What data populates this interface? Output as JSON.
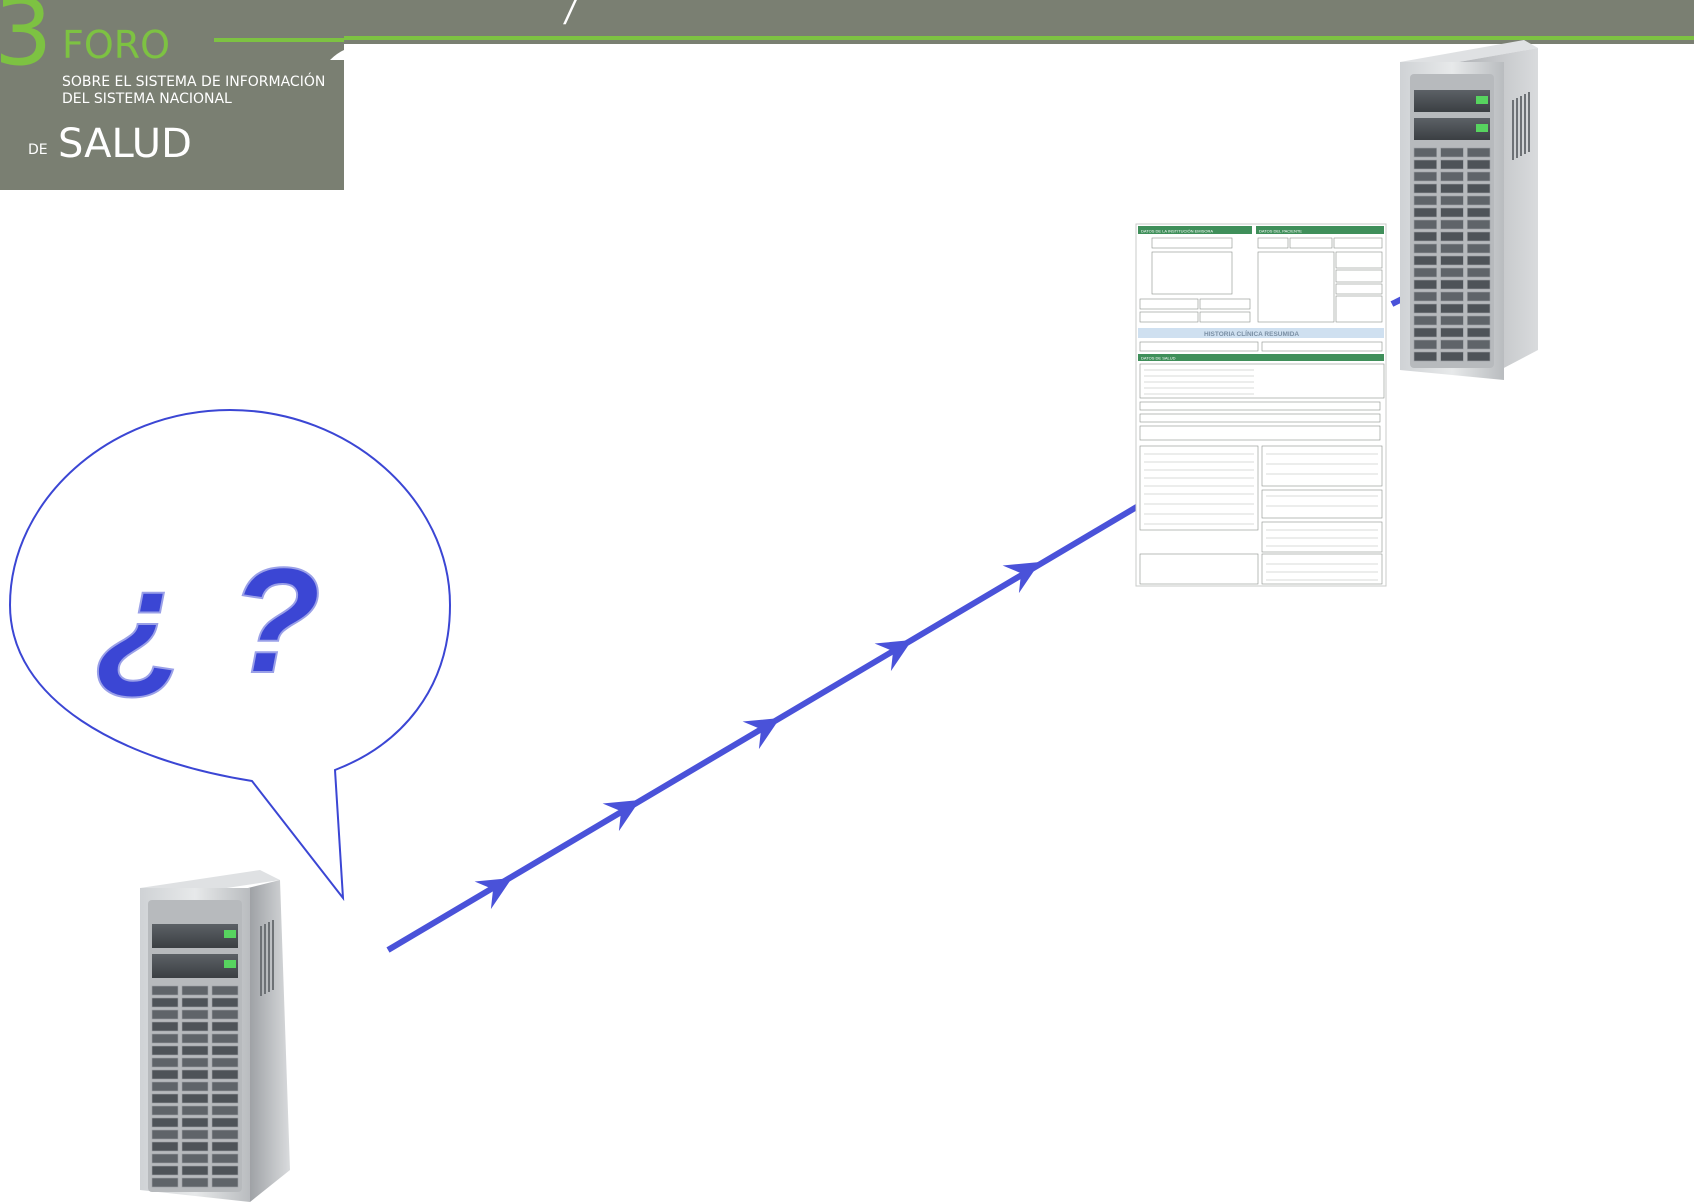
{
  "header": {
    "number": "3",
    "foro": "FORO",
    "line1": "SOBRE EL SISTEMA DE INFORMACIÓN",
    "line2": "DEL SISTEMA NACIONAL",
    "de": "DE",
    "salud": "SALUD",
    "title_fragment": "/"
  },
  "bubble": {
    "text": "¿ ?"
  },
  "document": {
    "section_institucion": "DATOS DE LA INSTITUCIÓN EMISORA",
    "section_paciente": "DATOS DEL PACIENTE",
    "title": "HISTORIA CLÍNICA RESUMIDA",
    "section_salud": "DATOS DE SALUD"
  },
  "colors": {
    "header_bg": "#7a7f72",
    "accent_green": "#7dc242",
    "arrow_blue": "#4a52d9",
    "question_blue": "#3b46d4",
    "doc_green": "#3f8f5a",
    "doc_header_blue": "#cfe0f0"
  },
  "icons": [
    "server-icon",
    "server-icon",
    "speech-bubble",
    "document-icon",
    "arrow-icon"
  ]
}
